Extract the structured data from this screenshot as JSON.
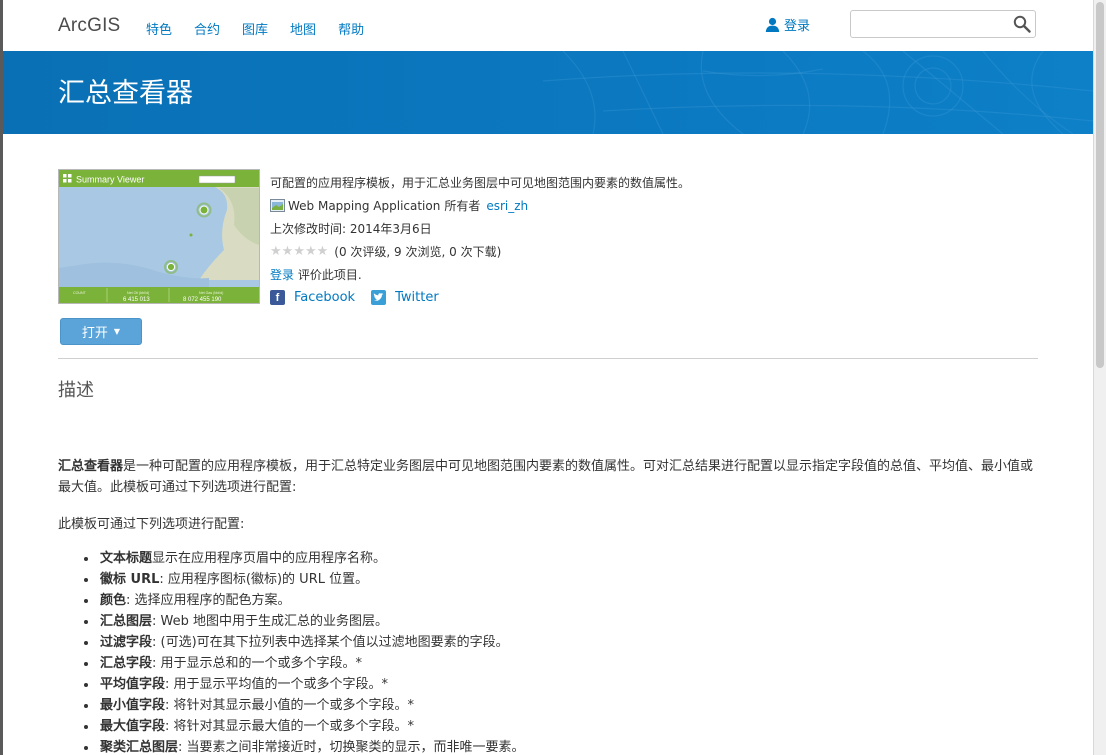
{
  "nav": {
    "logo": "ArcGIS",
    "links": [
      "特色",
      "合约",
      "图库",
      "地图",
      "帮助"
    ],
    "login": "登录",
    "search_value": "",
    "search_placeholder": ""
  },
  "banner": {
    "title": "汇总查看器"
  },
  "thumbnail": {
    "title": "Summary Viewer",
    "labels": [
      "COUNT",
      "Net Oil (bbl/d)",
      "Net Gas (bbl/d)"
    ],
    "values": [
      "6 415 013",
      "8 072 455 190"
    ]
  },
  "item": {
    "summary": "可配置的应用程序模板，用于汇总业务图层中可见地图范围内要素的数值属性。",
    "type": "Web Mapping Application",
    "owner_label": "所有者",
    "owner": "esri_zh",
    "modified": "上次修改时间: 2014年3月6日",
    "rating_text": "(0 次评级, 9 次浏览, 0 次下载)",
    "rating_value": 0,
    "rating_max": 5,
    "rate_login": "登录",
    "rate_suffix": " 评价此项目.",
    "facebook": "Facebook",
    "twitter": "Twitter",
    "open_button": "打开"
  },
  "description": {
    "section_title": "描述",
    "lead_bold": "汇总查看器",
    "lead_text": "是一种可配置的应用程序模板，用于汇总特定业务图层中可见地图范围内要素的数值属性。可对汇总结果进行配置以显示指定字段值的总值、平均值、最小值或最大值。此模板可通过下列选项进行配置:",
    "intro": "此模板可通过下列选项进行配置:",
    "options": [
      {
        "name": "文本标题",
        "text": "显示在应用程序页眉中的应用程序名称。"
      },
      {
        "name": "徽标 URL",
        "text": ": 应用程序图标(徽标)的 URL 位置。"
      },
      {
        "name": "颜色",
        "text": ": 选择应用程序的配色方案。"
      },
      {
        "name": "汇总图层",
        "text": ": Web 地图中用于生成汇总的业务图层。"
      },
      {
        "name": "过滤字段",
        "text": ": (可选)可在其下拉列表中选择某个值以过滤地图要素的字段。"
      },
      {
        "name": "汇总字段",
        "text": ": 用于显示总和的一个或多个字段。*"
      },
      {
        "name": "平均值字段",
        "text": ": 用于显示平均值的一个或多个字段。*"
      },
      {
        "name": "最小值字段",
        "text": ": 将针对其显示最小值的一个或多个字段。*"
      },
      {
        "name": "最大值字段",
        "text": ": 将针对其显示最大值的一个或多个字段。*"
      },
      {
        "name": "聚类汇总图层",
        "text": ": 当要素之间非常接近时，切换聚类的显示，而非唯一要素。"
      }
    ]
  },
  "colors": {
    "accent": "#0079c1",
    "banner": "#0b78c0",
    "button": "#5aa4d9"
  }
}
